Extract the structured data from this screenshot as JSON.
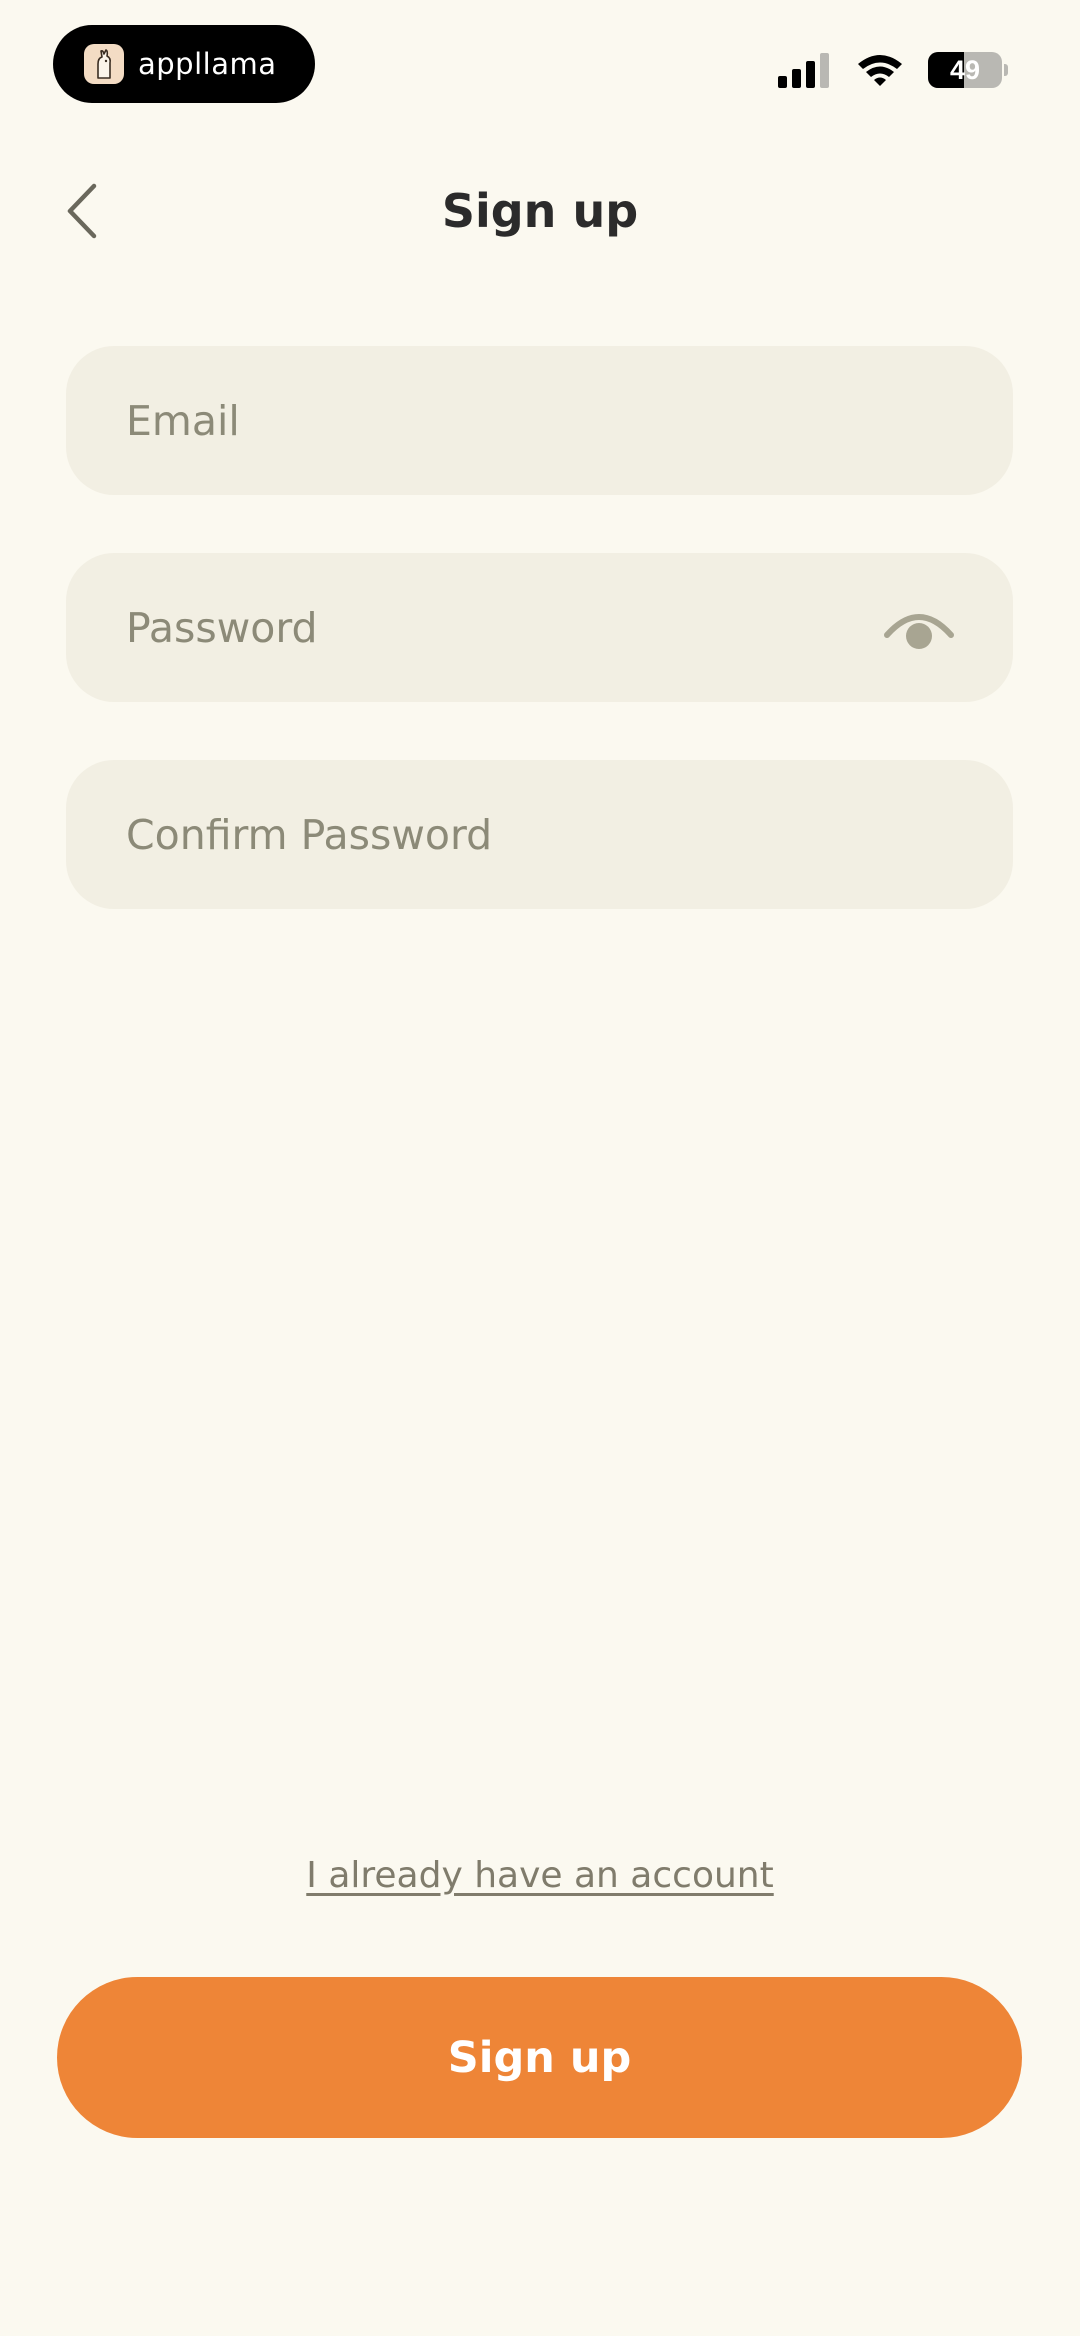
{
  "status_bar": {
    "app_name": "appllama",
    "battery_percent": "49",
    "battery_level": 0.49
  },
  "header": {
    "title": "Sign up",
    "back_icon": "chevron-left-icon"
  },
  "form": {
    "email_placeholder": "Email",
    "password_placeholder": "Password",
    "confirm_password_placeholder": "Confirm Password",
    "password_visibility_icon": "eye-icon"
  },
  "footer": {
    "login_link": "I already have an account",
    "signup_button": "Sign up"
  },
  "colors": {
    "background": "#fbf9f0",
    "field_background": "#f2efe3",
    "accent": "#ee8537",
    "placeholder": "#8c8a78"
  }
}
